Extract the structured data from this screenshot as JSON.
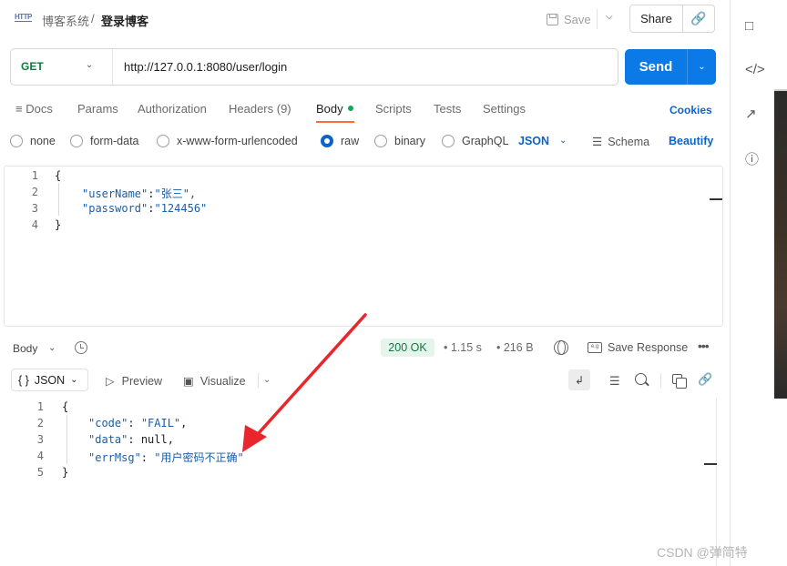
{
  "header": {
    "http_icon": "HTTP",
    "breadcrumb_parent": "博客系统",
    "breadcrumb_separator": "/",
    "breadcrumb_current": "登录博客",
    "save_label": "Save",
    "share_label": "Share"
  },
  "request": {
    "method": "GET",
    "url": "http://127.0.0.1:8080/user/login",
    "send_label": "Send"
  },
  "tabs": [
    {
      "label": "Docs"
    },
    {
      "label": "Params"
    },
    {
      "label": "Authorization"
    },
    {
      "label": "Headers (9)"
    },
    {
      "label": "Body"
    },
    {
      "label": "Scripts"
    },
    {
      "label": "Tests"
    },
    {
      "label": "Settings"
    }
  ],
  "cookies_label": "Cookies",
  "body_types": [
    {
      "label": "none",
      "checked": false
    },
    {
      "label": "form-data",
      "checked": false
    },
    {
      "label": "x-www-form-urlencoded",
      "checked": false
    },
    {
      "label": "raw",
      "checked": true
    },
    {
      "label": "binary",
      "checked": false
    },
    {
      "label": "GraphQL",
      "checked": false
    }
  ],
  "raw_format": "JSON",
  "schema_label": "Schema",
  "beautify_label": "Beautify",
  "request_body": {
    "line_numbers": [
      "1",
      "2",
      "3",
      "4"
    ],
    "open_brace": "{",
    "close_brace": "}",
    "fields": [
      {
        "key": "\"userName\"",
        "value": "\"张三\","
      },
      {
        "key": "\"password\"",
        "value": "\"124456\""
      }
    ]
  },
  "response": {
    "body_label": "Body",
    "status": "200 OK",
    "time": "1.15 s",
    "size": "216 B",
    "save_response_label": "Save Response",
    "format_label": "JSON",
    "preview_label": "Preview",
    "visualize_label": "Visualize",
    "line_numbers": [
      "1",
      "2",
      "3",
      "4",
      "5"
    ],
    "open_brace": "{",
    "close_brace": "}",
    "fields": [
      {
        "key": "\"code\"",
        "value": "\"FAIL\"",
        "tail": ","
      },
      {
        "key": "\"data\"",
        "value": "null",
        "tail": ","
      },
      {
        "key": "\"errMsg\"",
        "value": "\"用户密码不正确\"",
        "tail": ""
      }
    ]
  },
  "annotation_color": "#e8262b",
  "watermark": "CSDN @弹简特"
}
